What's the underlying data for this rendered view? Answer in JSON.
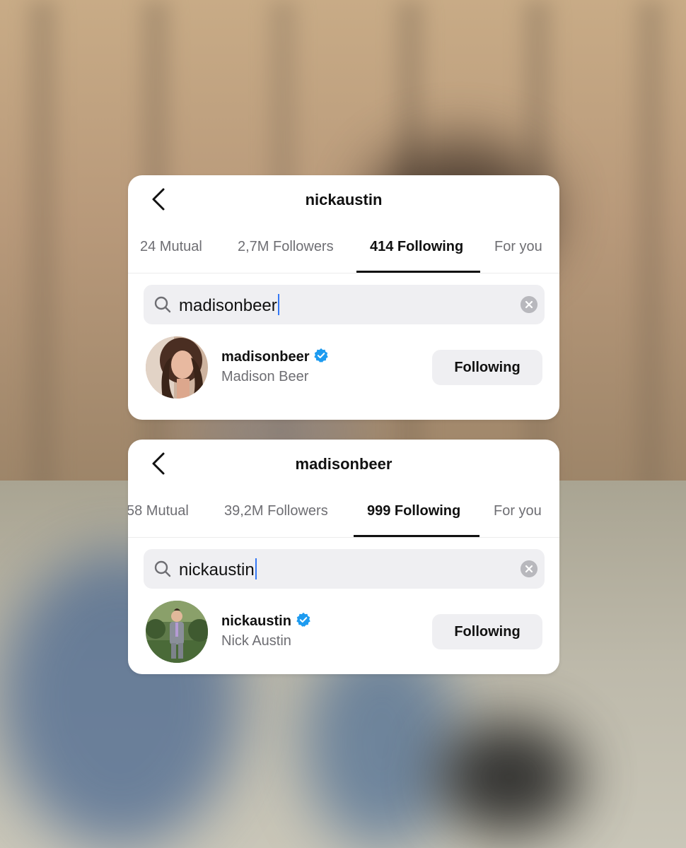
{
  "cards": [
    {
      "title": "nickaustin",
      "tabs": [
        "24 Mutual",
        "2,7M Followers",
        "414 Following",
        "For you"
      ],
      "search_value": "madisonbeer",
      "result": {
        "username": "madisonbeer",
        "full_name": "Madison Beer",
        "button_label": "Following",
        "verified": true
      }
    },
    {
      "title": "madisonbeer",
      "tabs": [
        "58 Mutual",
        "39,2M Followers",
        "999 Following",
        "For you"
      ],
      "search_value": "nickaustin",
      "result": {
        "username": "nickaustin",
        "full_name": "Nick Austin",
        "button_label": "Following",
        "verified": true
      }
    }
  ],
  "active_tab_index": 2,
  "colors": {
    "accent": "#3478f6",
    "verified": "#1d9bf0",
    "text_primary": "#111111",
    "text_secondary": "#6e6e73",
    "field_bg": "#efeff2"
  },
  "icons": [
    "back-chevron-icon",
    "search-icon",
    "clear-icon",
    "verified-badge-icon"
  ]
}
